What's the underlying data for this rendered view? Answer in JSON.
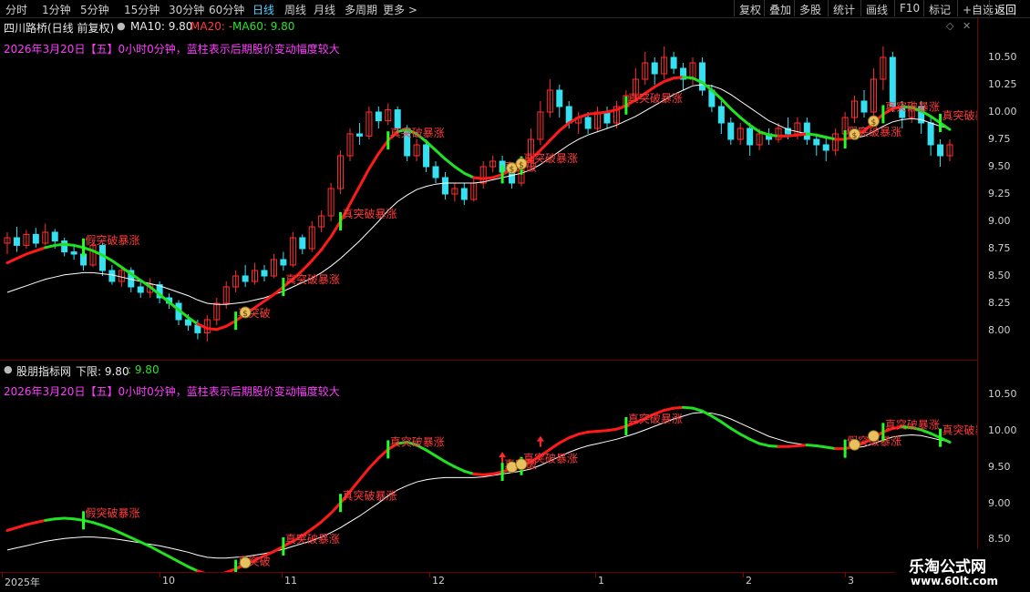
{
  "toolbar": {
    "periods": [
      "分时",
      "1分钟",
      "5分钟",
      "15分钟",
      "30分钟",
      "60分钟",
      "日线",
      "周线",
      "月线",
      "多周期",
      "更多 >"
    ],
    "active_period": "日线",
    "actions": [
      "复权",
      "叠加",
      "多股",
      "统计",
      "画线",
      "F10",
      "标记",
      "+自选",
      "返回"
    ]
  },
  "main_panel": {
    "stock_title": "四川路桥(日线 前复权)",
    "ma10_label": "MA10: 9.80",
    "ma20_label": "MA20: -",
    "ma60_label": "MA60: 9.80",
    "note": "2026年3月20日【五】0小时0分钟，蓝柱表示后期股价变动幅度较大",
    "y_ticks": [
      "10.50",
      "10.25",
      "10.00",
      "9.75",
      "9.50",
      "9.25",
      "9.00",
      "8.75",
      "8.50",
      "8.25",
      "8.00"
    ],
    "annotations": [
      "假突破暴涨",
      "真突破",
      "真突破暴涨",
      "真突破暴涨",
      "真突破暴涨",
      "真突破",
      "真突破暴涨",
      "真突破暴涨",
      "假突破暴涨",
      "真突破暴涨",
      "真突破暴涨"
    ]
  },
  "sub_panel": {
    "indicator_title": "股朋指标网",
    "lower_label": "下限: 9.80",
    "value_label": ": 9.80",
    "note": "2026年3月20日【五】0小时0分钟，蓝柱表示后期股价变动幅度较大",
    "y_ticks": [
      "10.50",
      "10.00",
      "9.50",
      "9.00",
      "8.50"
    ],
    "annotations": [
      "假突破暴涨",
      "真突破",
      "真突破暴涨",
      "真突破暴涨",
      "真突破暴涨",
      "真突破",
      "真突破暴涨",
      "真突破暴涨",
      "假突破暴涨",
      "真突破暴涨",
      "真突破暴涨"
    ]
  },
  "x_axis": {
    "labels": [
      "2025年",
      "10",
      "11",
      "12",
      "1",
      "2",
      "3"
    ]
  },
  "watermark": {
    "site_name": "乐淘公式网",
    "url": "www.60lt.com"
  },
  "chart_data": {
    "type": "candlestick",
    "y_range": [
      7.9,
      10.7
    ],
    "candles": [
      [
        8.8,
        8.85,
        8.7,
        8.9
      ],
      [
        8.85,
        8.78,
        8.72,
        8.95
      ],
      [
        8.78,
        8.88,
        8.75,
        8.92
      ],
      [
        8.88,
        8.8,
        8.76,
        8.94
      ],
      [
        8.8,
        8.9,
        8.78,
        8.98
      ],
      [
        8.9,
        8.82,
        8.75,
        8.93
      ],
      [
        8.82,
        8.72,
        8.68,
        8.85
      ],
      [
        8.72,
        8.7,
        8.65,
        8.78
      ],
      [
        8.7,
        8.6,
        8.55,
        8.74
      ],
      [
        8.6,
        8.78,
        8.58,
        8.82
      ],
      [
        8.78,
        8.55,
        8.5,
        8.8
      ],
      [
        8.55,
        8.45,
        8.42,
        8.6
      ],
      [
        8.45,
        8.55,
        8.4,
        8.58
      ],
      [
        8.55,
        8.4,
        8.35,
        8.58
      ],
      [
        8.4,
        8.35,
        8.3,
        8.45
      ],
      [
        8.35,
        8.42,
        8.3,
        8.48
      ],
      [
        8.42,
        8.3,
        8.25,
        8.45
      ],
      [
        8.3,
        8.25,
        8.2,
        8.34
      ],
      [
        8.25,
        8.1,
        8.05,
        8.28
      ],
      [
        8.1,
        8.05,
        8.0,
        8.15
      ],
      [
        8.05,
        7.98,
        7.92,
        8.1
      ],
      [
        7.98,
        8.1,
        7.9,
        8.14
      ],
      [
        8.1,
        8.25,
        8.05,
        8.3
      ],
      [
        8.25,
        8.4,
        8.2,
        8.45
      ],
      [
        8.4,
        8.5,
        8.35,
        8.55
      ],
      [
        8.5,
        8.45,
        8.4,
        8.6
      ],
      [
        8.45,
        8.55,
        8.42,
        8.62
      ],
      [
        8.55,
        8.5,
        8.45,
        8.6
      ],
      [
        8.5,
        8.65,
        8.48,
        8.7
      ],
      [
        8.65,
        8.6,
        8.55,
        8.72
      ],
      [
        8.6,
        8.85,
        8.58,
        8.9
      ],
      [
        8.85,
        8.75,
        8.7,
        8.88
      ],
      [
        8.75,
        8.95,
        8.72,
        9.0
      ],
      [
        8.95,
        9.05,
        8.9,
        9.1
      ],
      [
        9.05,
        9.3,
        9.0,
        9.35
      ],
      [
        9.3,
        9.6,
        9.25,
        9.65
      ],
      [
        9.6,
        9.8,
        9.55,
        9.85
      ],
      [
        9.8,
        9.78,
        9.7,
        9.9
      ],
      [
        9.78,
        10.0,
        9.75,
        10.05
      ],
      [
        10.0,
        9.92,
        9.85,
        10.05
      ],
      [
        9.92,
        10.02,
        9.88,
        10.08
      ],
      [
        10.02,
        9.85,
        9.8,
        10.05
      ],
      [
        9.85,
        9.6,
        9.55,
        9.88
      ],
      [
        9.6,
        9.7,
        9.55,
        9.75
      ],
      [
        9.7,
        9.5,
        9.45,
        9.75
      ],
      [
        9.5,
        9.4,
        9.35,
        9.55
      ],
      [
        9.4,
        9.25,
        9.2,
        9.45
      ],
      [
        9.25,
        9.3,
        9.18,
        9.35
      ],
      [
        9.3,
        9.2,
        9.15,
        9.35
      ],
      [
        9.2,
        9.35,
        9.18,
        9.4
      ],
      [
        9.35,
        9.5,
        9.3,
        9.55
      ],
      [
        9.5,
        9.55,
        9.45,
        9.6
      ],
      [
        9.55,
        9.45,
        9.4,
        9.6
      ],
      [
        9.45,
        9.35,
        9.3,
        9.5
      ],
      [
        9.35,
        9.55,
        9.32,
        9.6
      ],
      [
        9.55,
        9.75,
        9.5,
        9.85
      ],
      [
        9.75,
        10.0,
        9.7,
        10.1
      ],
      [
        10.0,
        10.2,
        9.95,
        10.3
      ],
      [
        10.2,
        10.05,
        9.95,
        10.25
      ],
      [
        10.05,
        9.9,
        9.85,
        10.1
      ],
      [
        9.9,
        9.95,
        9.8,
        10.0
      ],
      [
        9.95,
        9.85,
        9.8,
        10.0
      ],
      [
        9.85,
        10.0,
        9.82,
        10.05
      ],
      [
        10.0,
        9.9,
        9.85,
        10.05
      ],
      [
        9.9,
        10.05,
        9.85,
        10.1
      ],
      [
        10.05,
        10.15,
        10.0,
        10.2
      ],
      [
        10.15,
        10.3,
        10.1,
        10.4
      ],
      [
        10.3,
        10.45,
        10.25,
        10.55
      ],
      [
        10.45,
        10.35,
        10.25,
        10.5
      ],
      [
        10.35,
        10.5,
        10.3,
        10.6
      ],
      [
        10.5,
        10.4,
        10.35,
        10.55
      ],
      [
        10.4,
        10.3,
        10.2,
        10.45
      ],
      [
        10.3,
        10.45,
        10.25,
        10.5
      ],
      [
        10.45,
        10.2,
        10.15,
        10.5
      ],
      [
        10.2,
        10.05,
        10.0,
        10.25
      ],
      [
        10.05,
        9.9,
        9.8,
        10.1
      ],
      [
        9.9,
        9.75,
        9.7,
        9.95
      ],
      [
        9.75,
        9.85,
        9.7,
        9.9
      ],
      [
        9.85,
        9.7,
        9.6,
        9.9
      ],
      [
        9.7,
        9.8,
        9.65,
        9.85
      ],
      [
        9.8,
        9.75,
        9.7,
        9.85
      ],
      [
        9.75,
        9.85,
        9.72,
        9.9
      ],
      [
        9.85,
        9.8,
        9.75,
        9.95
      ],
      [
        9.8,
        9.9,
        9.75,
        9.95
      ],
      [
        9.9,
        9.75,
        9.7,
        9.95
      ],
      [
        9.75,
        9.7,
        9.6,
        9.8
      ],
      [
        9.7,
        9.65,
        9.55,
        9.78
      ],
      [
        9.65,
        9.8,
        9.6,
        9.85
      ],
      [
        9.8,
        9.95,
        9.75,
        10.0
      ],
      [
        9.95,
        10.1,
        9.9,
        10.15
      ],
      [
        10.1,
        10.0,
        9.95,
        10.2
      ],
      [
        10.0,
        10.3,
        9.95,
        10.4
      ],
      [
        10.3,
        10.5,
        10.2,
        10.6
      ],
      [
        10.5,
        10.05,
        10.0,
        10.55
      ],
      [
        10.05,
        9.95,
        9.85,
        10.1
      ],
      [
        9.95,
        10.05,
        9.9,
        10.1
      ],
      [
        10.05,
        9.9,
        9.8,
        10.1
      ],
      [
        9.9,
        9.7,
        9.6,
        9.95
      ],
      [
        9.7,
        9.6,
        9.5,
        9.75
      ],
      [
        9.6,
        9.7,
        9.55,
        9.75
      ]
    ],
    "ma_white": [
      8.35,
      8.38,
      8.41,
      8.44,
      8.47,
      8.49,
      8.51,
      8.52,
      8.53,
      8.53,
      8.52,
      8.51,
      8.49,
      8.47,
      8.45,
      8.43,
      8.41,
      8.38,
      8.35,
      8.32,
      8.28,
      8.25,
      8.24,
      8.24,
      8.25,
      8.26,
      8.28,
      8.3,
      8.33,
      8.36,
      8.4,
      8.44,
      8.48,
      8.53,
      8.59,
      8.66,
      8.74,
      8.82,
      8.91,
      9.0,
      9.1,
      9.18,
      9.24,
      9.29,
      9.32,
      9.34,
      9.35,
      9.35,
      9.35,
      9.35,
      9.36,
      9.38,
      9.4,
      9.42,
      9.44,
      9.47,
      9.52,
      9.58,
      9.64,
      9.7,
      9.75,
      9.79,
      9.82,
      9.85,
      9.88,
      9.92,
      9.96,
      10.01,
      10.06,
      10.11,
      10.16,
      10.2,
      10.24,
      10.25,
      10.24,
      10.21,
      10.16,
      10.1,
      10.04,
      9.98,
      9.92,
      9.88,
      9.84,
      9.82,
      9.8,
      9.78,
      9.76,
      9.75,
      9.75,
      9.76,
      9.78,
      9.82,
      9.87,
      9.91,
      9.93,
      9.94,
      9.93,
      9.9,
      9.87,
      9.85
    ],
    "ma_color": [
      8.62,
      8.66,
      8.7,
      8.73,
      8.76,
      8.78,
      8.79,
      8.78,
      8.76,
      8.73,
      8.69,
      8.64,
      8.58,
      8.52,
      8.46,
      8.4,
      8.33,
      8.26,
      8.19,
      8.12,
      8.06,
      8.02,
      8.01,
      8.04,
      8.09,
      8.15,
      8.21,
      8.27,
      8.33,
      8.4,
      8.47,
      8.55,
      8.64,
      8.74,
      8.86,
      9.0,
      9.16,
      9.32,
      9.48,
      9.62,
      9.74,
      9.82,
      9.84,
      9.8,
      9.73,
      9.65,
      9.57,
      9.5,
      9.44,
      9.4,
      9.39,
      9.4,
      9.43,
      9.47,
      9.51,
      9.57,
      9.65,
      9.74,
      9.83,
      9.9,
      9.95,
      9.98,
      9.99,
      10.0,
      10.02,
      10.06,
      10.11,
      10.17,
      10.23,
      10.28,
      10.31,
      10.32,
      10.31,
      10.27,
      10.2,
      10.12,
      10.03,
      9.95,
      9.88,
      9.82,
      9.79,
      9.78,
      9.78,
      9.79,
      9.8,
      9.79,
      9.77,
      9.75,
      9.75,
      9.78,
      9.83,
      9.9,
      9.98,
      10.03,
      10.05,
      10.04,
      10.01,
      9.96,
      9.9,
      9.84
    ],
    "ma_color_up": [
      false,
      true,
      true,
      true,
      true,
      false,
      false,
      false,
      false,
      false,
      false,
      false,
      false,
      false,
      false,
      false,
      false,
      false,
      false,
      false,
      false,
      true,
      true,
      true,
      true,
      true,
      true,
      true,
      true,
      true,
      true,
      true,
      true,
      true,
      true,
      true,
      true,
      true,
      true,
      true,
      true,
      true,
      false,
      false,
      false,
      false,
      false,
      false,
      false,
      false,
      true,
      true,
      true,
      true,
      true,
      true,
      true,
      true,
      true,
      true,
      true,
      true,
      true,
      true,
      true,
      true,
      true,
      true,
      true,
      true,
      true,
      true,
      false,
      false,
      false,
      false,
      false,
      false,
      false,
      false,
      false,
      false,
      true,
      true,
      true,
      false,
      false,
      false,
      true,
      true,
      true,
      true,
      true,
      true,
      true,
      false,
      false,
      false,
      false,
      false
    ]
  }
}
